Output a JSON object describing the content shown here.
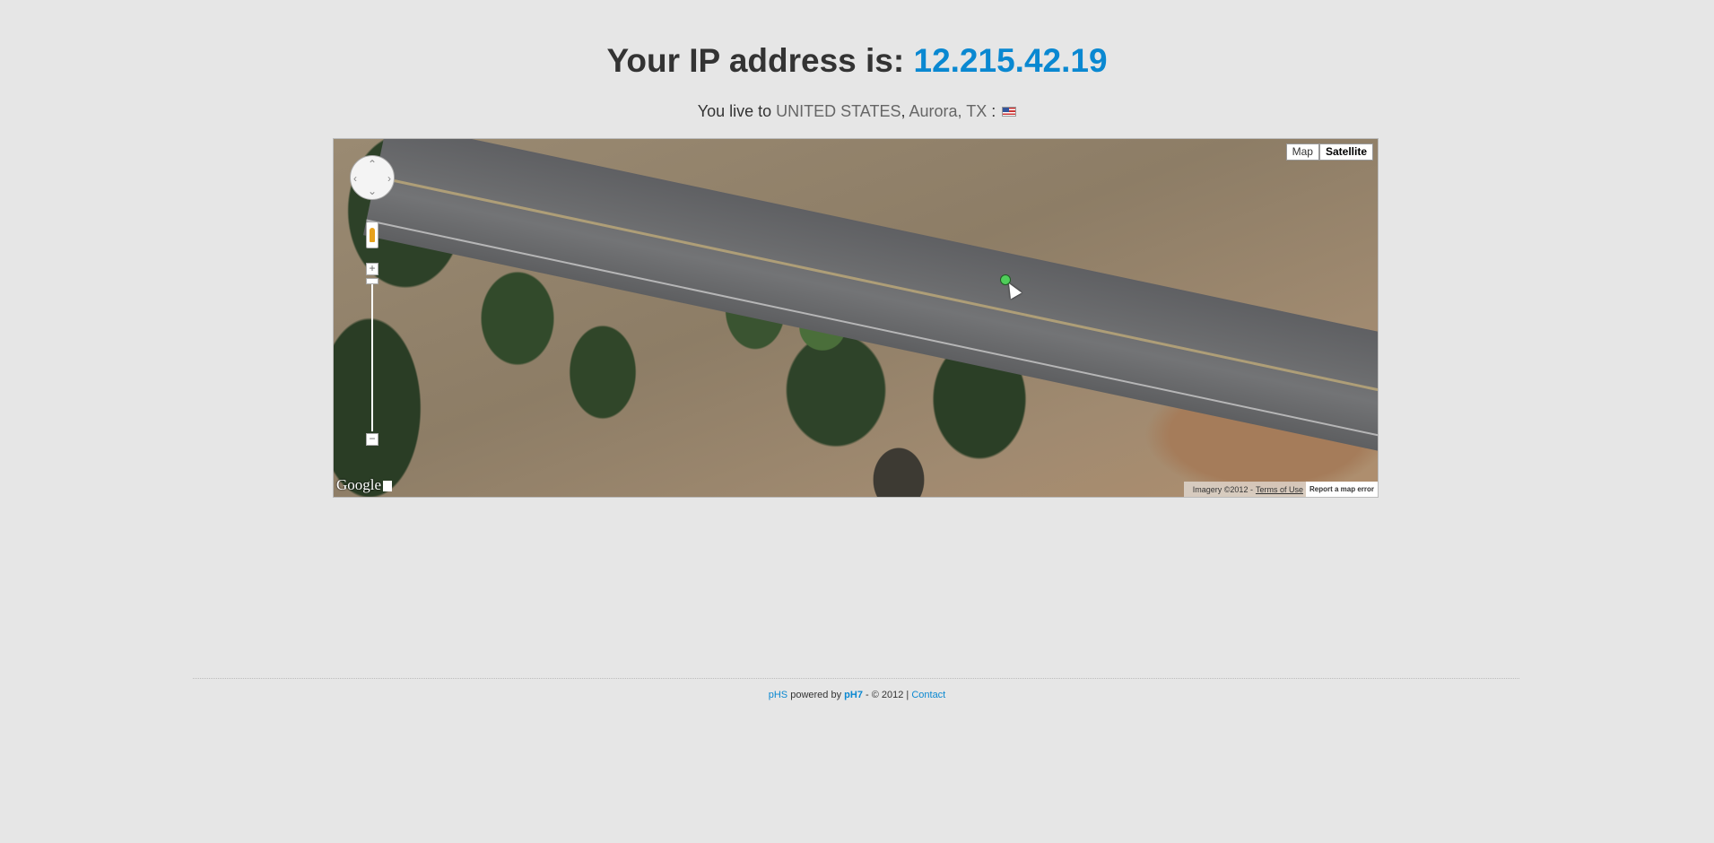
{
  "header": {
    "title_prefix": "Your IP address is:",
    "ip": "12.215.42.19",
    "accent_color": "#0a88d1"
  },
  "location": {
    "prefix": "You live to",
    "country": "UNITED STATES",
    "separator": ",",
    "city": "Aurora, TX",
    "colon": ":",
    "flag_icon": "us-flag-icon"
  },
  "map": {
    "type_buttons": [
      "Map",
      "Satellite"
    ],
    "active_type": "Satellite",
    "logo": "Google",
    "imagery": "Imagery ©2012 -",
    "terms": "Terms of Use",
    "report": "Report a map error",
    "zoom_in": "+",
    "zoom_out": "−"
  },
  "footer": {
    "site": "pHS",
    "powered_by": "powered by",
    "engine": "pH7",
    "copyright": "- © 2012 |",
    "contact": "Contact"
  }
}
